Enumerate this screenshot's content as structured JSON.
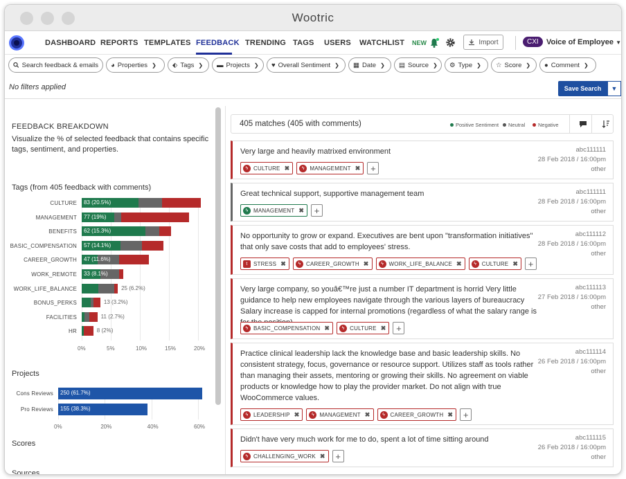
{
  "window": {
    "title": "Wootric"
  },
  "nav": {
    "items": [
      "DASHBOARD",
      "REPORTS",
      "TEMPLATES",
      "FEEDBACK",
      "TRENDING",
      "TAGS",
      "USERS",
      "WATCHLIST"
    ],
    "active": "FEEDBACK",
    "new_label": "NEW",
    "import_label": "Import",
    "cxi_label": "CXI",
    "workspace_label": "Voice of Employee"
  },
  "filters": {
    "search_placeholder": "Search feedback & emails",
    "buttons": [
      "Properties",
      "Tags",
      "Projects",
      "Overall Sentiment",
      "Date",
      "Source",
      "Type",
      "Score",
      "Comment"
    ],
    "no_filters": "No filters applied",
    "save_search": "Save Search"
  },
  "breakdown": {
    "title": "FEEDBACK BREAKDOWN",
    "description": "Visualize the % of selected feedback that contains specific tags, sentiment, and properties.",
    "tags_label": "Tags (from 405 feedback with comments)",
    "projects_label": "Projects",
    "scores_label": "Scores",
    "sources_label": "Sources"
  },
  "colors": {
    "positive": "#1f7a4d",
    "neutral": "#666666",
    "negative": "#b52a2a",
    "project": "#1e55a8"
  },
  "chart_data": [
    {
      "type": "bar",
      "orientation": "horizontal",
      "stacked": true,
      "categories": [
        "CULTURE",
        "MANAGEMENT",
        "BENEFITS",
        "BASIC_COMPENSATION",
        "CAREER_GROWTH",
        "WORK_REMOTE",
        "WORK_LIFE_BALANCE",
        "BONUS_PERKS",
        "FACILITIES",
        "HR"
      ],
      "labels": [
        "83 (20.5%)",
        "77 (19%)",
        "62 (15.3%)",
        "57 (14.1%)",
        "47 (11.6%)",
        "33 (8.1%)",
        "25 (6.2%)",
        "13 (3.2%)",
        "11 (2.7%)",
        "8 (2%)"
      ],
      "series": [
        {
          "name": "Positive Sentiment",
          "values": [
            9.8,
            5.6,
            11.0,
            6.7,
            2.7,
            3.2,
            2.8,
            1.5,
            0.5,
            0.3
          ]
        },
        {
          "name": "Neutral",
          "values": [
            4.0,
            1.2,
            2.3,
            3.7,
            3.7,
            3.2,
            2.8,
            0.5,
            0.8,
            0.0
          ]
        },
        {
          "name": "Negative",
          "values": [
            6.7,
            11.7,
            2.0,
            3.7,
            5.2,
            0.7,
            0.6,
            1.2,
            1.4,
            1.7
          ]
        }
      ],
      "ticks": [
        "0%",
        "5%",
        "10%",
        "15%",
        "20%"
      ],
      "xlim": [
        0,
        20
      ]
    },
    {
      "type": "bar",
      "orientation": "horizontal",
      "categories": [
        "Cons Reviews",
        "Pro Reviews"
      ],
      "labels": [
        "250 (61.7%)",
        "155 (38.3%)"
      ],
      "values": [
        61.7,
        38.3
      ],
      "ticks": [
        "0%",
        "20%",
        "40%",
        "60%"
      ],
      "xlim": [
        0,
        60
      ]
    }
  ],
  "feedback": {
    "matches": "405 matches (405 with comments)",
    "legend": [
      "Positive Sentiment",
      "Neutral",
      "Negative"
    ],
    "cards": [
      {
        "text": "Very large and heavily matrixed environment",
        "id": "abc111111",
        "date": "28 Feb 2018 / 16:00pm",
        "source": "other",
        "sentiment": "negative",
        "tags": [
          {
            "label": "CULTURE",
            "s": "neg"
          },
          {
            "label": "MANAGEMENT",
            "s": "neg"
          }
        ]
      },
      {
        "text": "Great technical support, supportive management team",
        "id": "abc111111",
        "date": "28 Feb 2018 / 16:00pm",
        "source": "other",
        "sentiment": "neutral",
        "tags": [
          {
            "label": "MANAGEMENT",
            "s": "pos"
          }
        ]
      },
      {
        "text": "No opportunity to grow or expand. Executives are bent upon \"transformation initiatives\" that only save costs that add to employees' stress.",
        "id": "abc111112",
        "date": "28 Feb 2018 / 16:00pm",
        "source": "other",
        "sentiment": "negative",
        "tags": [
          {
            "label": "STRESS",
            "s": "neg"
          },
          {
            "label": "CAREER_GROWTH",
            "s": "neg"
          },
          {
            "label": "WORK_LIFE_BALANCE",
            "s": "neg"
          },
          {
            "label": "CULTURE",
            "s": "neg"
          }
        ]
      },
      {
        "text": "Very large company, so youâ€™re just a number IT department is horrid Very little guidance to help new employees navigate through the various layers of bureaucracy Salary increase is capped for internal promotions (regardless of what the salary range is for the position)",
        "id": "abc111113",
        "date": "27 Feb 2018 / 16:00pm",
        "source": "other",
        "sentiment": "negative",
        "tags": [
          {
            "label": "BASIC_COMPENSATION",
            "s": "neg"
          },
          {
            "label": "CULTURE",
            "s": "neg"
          }
        ]
      },
      {
        "text": "Practice clinical leadership lack the knowledge base and basic leadership skills. No consistent strategy, focus, governance or resource support. Utilizes staff as tools rather than managing their assets, mentoring or growing their skills. No agreement on viable products or knowledge how to play the provider market. Do not align with true WooCommerce values.",
        "id": "abc111114",
        "date": "26 Feb 2018 / 16:00pm",
        "source": "other",
        "sentiment": "negative",
        "tags": [
          {
            "label": "LEADERSHIP",
            "s": "neg"
          },
          {
            "label": "MANAGEMENT",
            "s": "neg"
          },
          {
            "label": "CAREER_GROWTH",
            "s": "neg"
          }
        ]
      },
      {
        "text": "Didn't have very much work for me to do, spent a lot of time sitting around",
        "id": "abc111115",
        "date": "26 Feb 2018 / 16:00pm",
        "source": "other",
        "sentiment": "negative",
        "tags": [
          {
            "label": "CHALLENGING_WORK",
            "s": "neg"
          }
        ]
      }
    ]
  }
}
